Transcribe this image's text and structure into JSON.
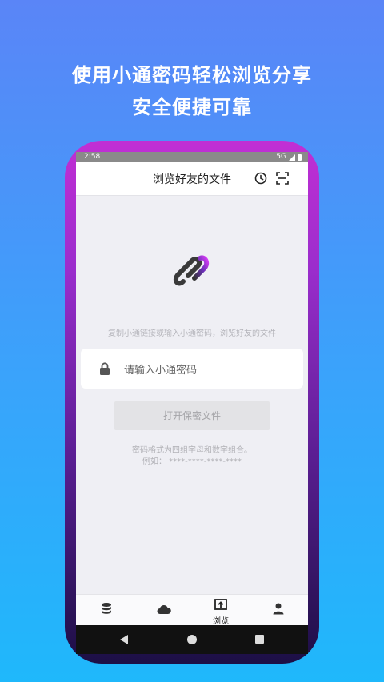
{
  "headline": {
    "line1": "使用小通密码轻松浏览分享",
    "line2": "安全便捷可靠"
  },
  "status_bar": {
    "time": "2:58",
    "network": "5G"
  },
  "app_bar": {
    "title": "浏览好友的文件",
    "icons": [
      "history-icon",
      "scan-icon"
    ]
  },
  "main": {
    "hint": "复制小通链接或输入小通密码，浏览好友的文件",
    "password_input": {
      "placeholder": "请输入小通密码",
      "value": ""
    },
    "open_button_label": "打开保密文件",
    "format_note": "密码格式为四组字母和数字组合。",
    "example": "例如： ****-****-****-****"
  },
  "tab_bar": {
    "tabs": [
      {
        "icon": "database-icon",
        "label": ""
      },
      {
        "icon": "cloud-icon",
        "label": ""
      },
      {
        "icon": "browse-icon",
        "label": "浏览",
        "active": true
      },
      {
        "icon": "person-icon",
        "label": ""
      }
    ]
  },
  "colors": {
    "background_top": "#5a85f7",
    "background_bottom": "#1fb8fb",
    "phone_frame_top": "#c12fd4",
    "phone_frame_bottom": "#1c0f45",
    "logo_accent": "#c03cf0"
  }
}
